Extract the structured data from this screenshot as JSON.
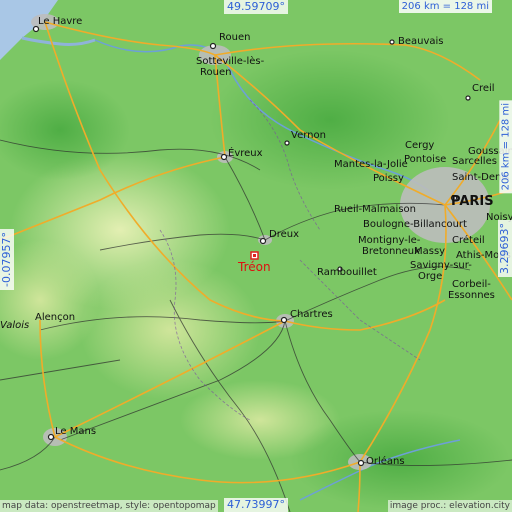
{
  "map": {
    "target": {
      "name": "Tréon"
    },
    "coordinates": {
      "north": "49.59709°",
      "south": "47.73997°",
      "west": "-0.07957°",
      "east": "3.29693°"
    },
    "scale": {
      "horizontal": "206 km = 128 mi",
      "vertical": "206 km = 128 mi"
    },
    "credits": {
      "left": "map data: openstreetmap, style: opentopomap",
      "right": "image proc.: elevation.city"
    },
    "cities": {
      "le_havre": "Le Havre",
      "rouen": "Rouen",
      "sotteville": "Sotteville-lès-\nRouen",
      "beauvais": "Beauvais",
      "creil": "Creil",
      "vernon": "Vernon",
      "evreux": "Évreux",
      "cergy": "Cergy",
      "goussainville": "Goussainville",
      "mantes": "Mantes-la-Jolie",
      "pontoise": "Pontoise",
      "sarcelles": "Sarcelles",
      "poissy": "Poissy",
      "saint_denis": "Saint-Denis",
      "paris": "PARIS",
      "rueil": "Rueil-Malmaison",
      "boulogne": "Boulogne-Billancourt",
      "noisy": "Noisy",
      "dreux": "Dreux",
      "montigny": "Montigny-le-",
      "bretonneux": "Bretonneux",
      "massy": "Massy",
      "creteil": "Créteil",
      "athis": "Athis-Mons",
      "rambouillet": "Rambouillet",
      "savigny": "Savigny-sur-",
      "orge": "Orge",
      "corbeil": "Corbeil-",
      "essonnes": "Essonnes",
      "alencon": "Alençon",
      "valois": "Valois",
      "chartres": "Chartres",
      "le_mans": "Le Mans",
      "orleans": "Orléans"
    }
  },
  "colors": {
    "sea": "#a9c7e6",
    "lowland": "#6fc05a",
    "midland": "#9bd27a",
    "highland": "#d3e6a0",
    "roads_major": "#f2b230",
    "roads_minor": "#222222",
    "urban": "#b9b9b9",
    "target_marker": "#e02020"
  }
}
